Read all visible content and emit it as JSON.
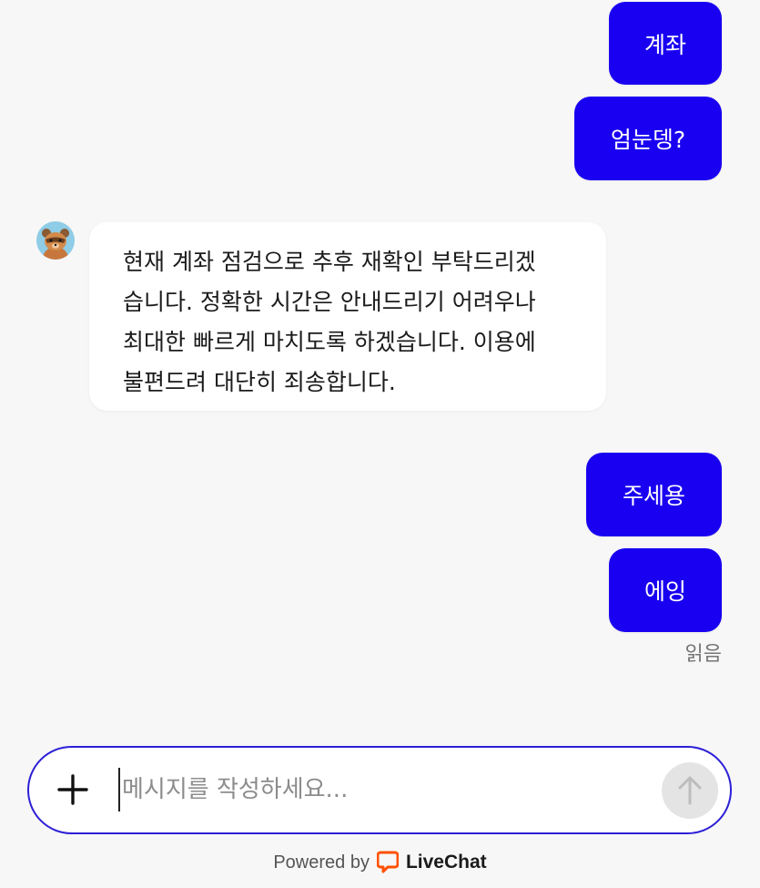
{
  "colors": {
    "outgoing_bubble": "#1900f0",
    "outgoing_text": "#ffffff",
    "incoming_bubble": "#ffffff",
    "background": "#f7f7f7",
    "composer_border": "#2c1fd6",
    "livechat_orange": "#ff5100"
  },
  "messages": {
    "outgoing_1": "계좌",
    "outgoing_2": "엄눈뎅?",
    "incoming_1_line_1": "현재 계좌 점검으로 추후 재확인 부탁드리겠",
    "incoming_1_line_2": "습니다. 정확한 시간은 안내드리기 어려우나",
    "incoming_1_line_3": "최대한 빠르게 마치도록 하겠습니다. 이용에",
    "incoming_1_line_4": "불편드려 대단히 죄송합니다.",
    "outgoing_3": "주세용",
    "outgoing_4": "에잉"
  },
  "status": {
    "read": "읽음"
  },
  "composer": {
    "placeholder": "메시지를 작성하세요...",
    "value": "",
    "attach_icon": "plus-icon",
    "send_icon": "arrow-up-icon"
  },
  "agent": {
    "avatar_icon": "raccoon-avatar"
  },
  "footer": {
    "powered_by": "Powered by",
    "brand": "LiveChat"
  }
}
